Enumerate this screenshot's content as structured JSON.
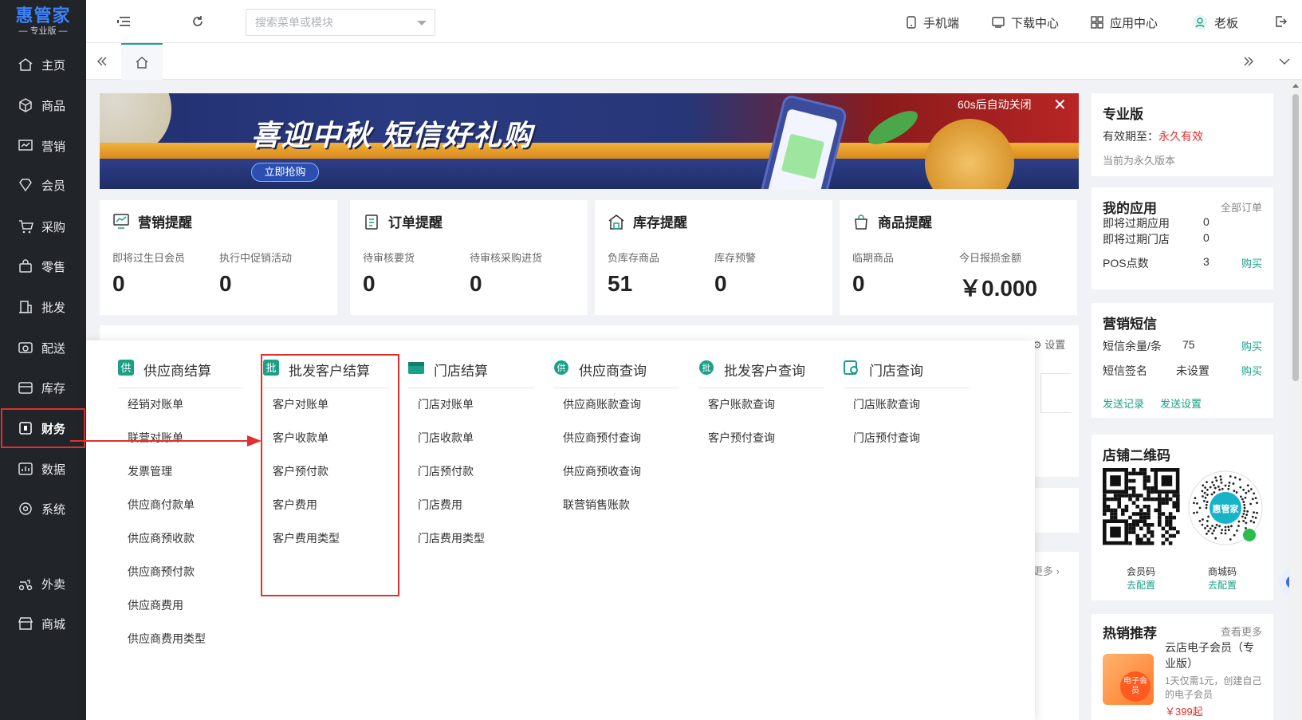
{
  "app": {
    "logo": "惠管家",
    "edition": "专业版"
  },
  "sidebar": {
    "items": [
      {
        "label": "主页",
        "icon": "home-icon"
      },
      {
        "label": "商品",
        "icon": "box-icon"
      },
      {
        "label": "营销",
        "icon": "chart-icon"
      },
      {
        "label": "会员",
        "icon": "diamond-icon"
      },
      {
        "label": "采购",
        "icon": "cart-icon"
      },
      {
        "label": "零售",
        "icon": "bag-icon"
      },
      {
        "label": "批发",
        "icon": "building-icon"
      },
      {
        "label": "配送",
        "icon": "truck-icon"
      },
      {
        "label": "库存",
        "icon": "warehouse-icon"
      },
      {
        "label": "财务",
        "icon": "finance-icon"
      },
      {
        "label": "数据",
        "icon": "data-icon"
      },
      {
        "label": "系统",
        "icon": "system-icon"
      },
      {
        "label": "外卖",
        "icon": "delivery-icon"
      },
      {
        "label": "商城",
        "icon": "store-icon"
      }
    ]
  },
  "topbar": {
    "search_placeholder": "搜索菜单或模块",
    "links": {
      "mobile": "手机端",
      "download": "下载中心",
      "apps": "应用中心",
      "user": "老板"
    }
  },
  "banner": {
    "title": "喜迎中秋  短信好礼购",
    "button": "立即抢购",
    "countdown": "60s后自动关闭",
    "close": "✕"
  },
  "cards": [
    {
      "title": "营销提醒",
      "icon": "monitor-icon",
      "items": [
        {
          "label": "即将过生日会员",
          "value": "0"
        },
        {
          "label": "执行中促销活动",
          "value": "0"
        }
      ]
    },
    {
      "title": "订单提醒",
      "icon": "clipboard-icon",
      "items": [
        {
          "label": "待审核要货",
          "value": "0"
        },
        {
          "label": "待审核采购进货",
          "value": "0"
        }
      ]
    },
    {
      "title": "库存提醒",
      "icon": "house-icon",
      "items": [
        {
          "label": "负库存商品",
          "value": "51"
        },
        {
          "label": "库存预警",
          "value": "0"
        }
      ]
    },
    {
      "title": "商品提醒",
      "icon": "shopping-bag-icon",
      "items": [
        {
          "label": "临期商品",
          "value": "0"
        },
        {
          "label": "今日报损金额",
          "value": "￥0.000"
        }
      ]
    }
  ],
  "hidden_fragments": {
    "settings": "设置",
    "more": "更多"
  },
  "finance_menu": {
    "columns": [
      {
        "title": "供应商结算",
        "icon": "supplier-icon",
        "items": [
          "经销对账单",
          "联营对账单",
          "发票管理",
          "供应商付款单",
          "供应商预收款",
          "供应商预付款",
          "供应商费用",
          "供应商费用类型"
        ]
      },
      {
        "title": "批发客户结算",
        "icon": "wholesale-icon",
        "items": [
          "客户对账单",
          "客户收款单",
          "客户预付款",
          "客户费用",
          "客户费用类型"
        ]
      },
      {
        "title": "门店结算",
        "icon": "shop-icon",
        "items": [
          "门店对账单",
          "门店收款单",
          "门店预付款",
          "门店费用",
          "门店费用类型"
        ]
      },
      {
        "title": "供应商查询",
        "icon": "supplier-query-icon",
        "items": [
          "供应商账款查询",
          "供应商预付查询",
          "供应商预收查询",
          "联营销售账款"
        ]
      },
      {
        "title": "批发客户查询",
        "icon": "wholesale-query-icon",
        "items": [
          "客户账款查询",
          "客户预付查询"
        ]
      },
      {
        "title": "门店查询",
        "icon": "shop-query-icon",
        "items": [
          "门店账款查询",
          "门店预付查询"
        ]
      }
    ]
  },
  "right_panel": {
    "edition": {
      "title": "专业版",
      "validity_label": "有效期至：",
      "validity_value": "永久有效",
      "note": "当前为永久版本"
    },
    "my_apps": {
      "title": "我的应用",
      "all_orders": "全部订单",
      "rows": [
        {
          "label": "即将过期应用",
          "value": "0"
        },
        {
          "label": "即将过期门店",
          "value": "0"
        },
        {
          "label": "POS点数",
          "value": "3",
          "action": "购买"
        }
      ]
    },
    "sms": {
      "title": "营销短信",
      "rows": [
        {
          "label": "短信余量/条",
          "value": "75",
          "action": "购买"
        },
        {
          "label": "短信签名",
          "value": "未设置",
          "action": "购买"
        }
      ],
      "links": [
        "发送记录",
        "发送设置"
      ]
    },
    "qrcode": {
      "title": "店铺二维码",
      "codes": [
        {
          "label": "会员码",
          "action": "去配置"
        },
        {
          "label": "商城码",
          "action": "去配置"
        }
      ],
      "mini_logo": "惠管家"
    },
    "hot": {
      "title": "热销推荐",
      "more": "查看更多",
      "product": "云店电子会员（专业版）",
      "desc": "1天仅需1元，创建自己的电子会员",
      "badge": "电子会员",
      "price": "￥399起"
    }
  },
  "colors": {
    "sidebar_bg": "#212429",
    "accent": "#1aa086",
    "highlight": "#e03030",
    "brand": "#3b82f6"
  }
}
